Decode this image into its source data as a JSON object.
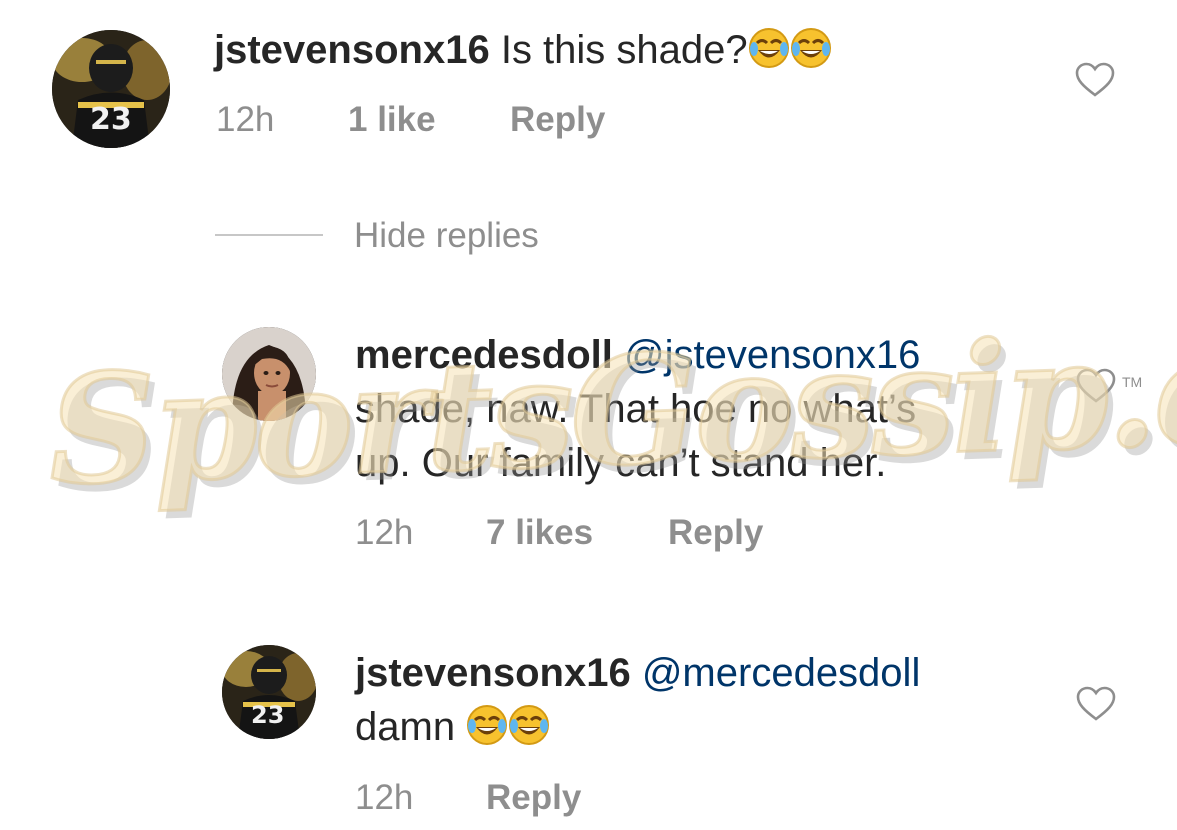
{
  "comments": [
    {
      "username": "jstevensonx16",
      "text": "Is this shade?",
      "emojis": [
        "face-with-tears-of-joy",
        "face-with-tears-of-joy"
      ],
      "time": "12h",
      "likes": "1 like",
      "reply_label": "Reply",
      "avatar_number": "23"
    }
  ],
  "hide_replies_label": "Hide replies",
  "replies": [
    {
      "username": "mercedesdoll",
      "mention": "@jstevensonx16",
      "text_line1": "shade, naw. That hoe no what’s",
      "text_line2": "up. Our family can’t stand her.",
      "time": "12h",
      "likes": "7 likes",
      "reply_label": "Reply"
    },
    {
      "username": "jstevensonx16",
      "mention": "@mercedesdoll",
      "text": "damn",
      "emojis": [
        "face-with-tears-of-joy",
        "face-with-tears-of-joy"
      ],
      "time": "12h",
      "reply_label": "Reply",
      "avatar_number": "23"
    }
  ],
  "watermark": {
    "text": "SportsGossip.com",
    "trademark": "TM"
  },
  "colors": {
    "text": "#262626",
    "meta": "#8e8e8e",
    "mention": "#003569",
    "divider": "#c7c7c7"
  }
}
